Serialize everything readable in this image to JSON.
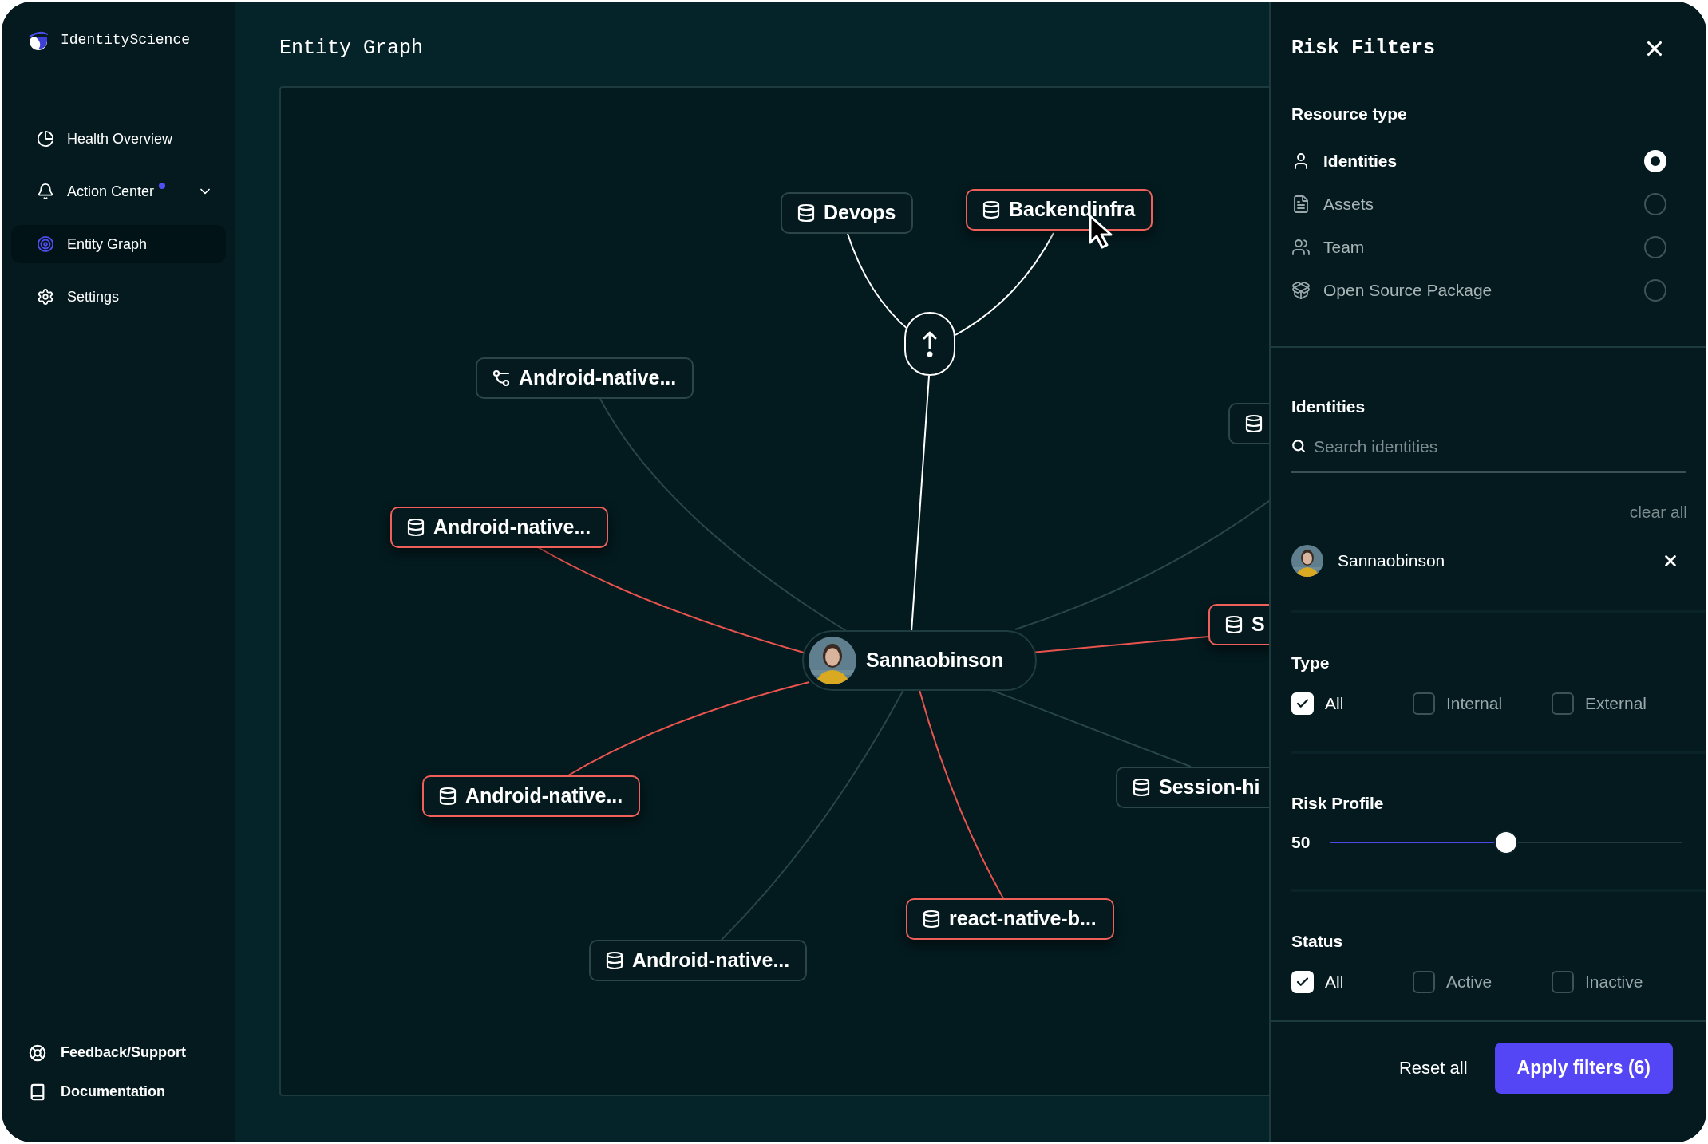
{
  "sidebar": {
    "brand": "IdentityScience",
    "nav": [
      {
        "label": "Health Overview",
        "selected": false,
        "notification": false,
        "expandable": false
      },
      {
        "label": "Action Center",
        "selected": false,
        "notification": true,
        "expandable": true
      },
      {
        "label": "Entity Graph",
        "selected": true,
        "notification": false,
        "expandable": false
      },
      {
        "label": "Settings",
        "selected": false,
        "notification": false,
        "expandable": false
      }
    ],
    "footer": [
      {
        "label": "Feedback/Support"
      },
      {
        "label": "Documentation"
      }
    ]
  },
  "main": {
    "title": "Entity Graph",
    "graph": {
      "center": {
        "label": "Sannaobinson"
      },
      "nodes": [
        {
          "label": "Devops",
          "kind": "database",
          "flagged": false
        },
        {
          "label": "Backendinfra",
          "kind": "database",
          "flagged": true
        },
        {
          "label": "Android-native...",
          "kind": "branch",
          "flagged": false
        },
        {
          "label": "Android-native...",
          "kind": "database",
          "flagged": true
        },
        {
          "kind": "database",
          "flagged": false
        },
        {
          "label": "S",
          "kind": "database",
          "flagged": true
        },
        {
          "label": "Session-hi",
          "kind": "database",
          "flagged": false
        },
        {
          "label": "Android-native...",
          "kind": "database",
          "flagged": true
        },
        {
          "label": "react-native-b...",
          "kind": "database",
          "flagged": true
        },
        {
          "label": "Android-native...",
          "kind": "database",
          "flagged": false
        }
      ]
    }
  },
  "filters": {
    "title": "Risk Filters",
    "resource_type": {
      "title": "Resource type",
      "options": [
        {
          "label": "Identities",
          "selected": true
        },
        {
          "label": "Assets",
          "selected": false
        },
        {
          "label": "Team",
          "selected": false
        },
        {
          "label": "Open Source Package",
          "selected": false
        }
      ]
    },
    "identities": {
      "title": "Identities",
      "search": {
        "placeholder": "Search identities"
      },
      "clear_all": "clear all",
      "chosen": [
        {
          "name": "Sannaobinson"
        }
      ]
    },
    "type": {
      "title": "Type",
      "options": [
        {
          "label": "All",
          "checked": true
        },
        {
          "label": "Internal",
          "checked": false
        },
        {
          "label": "External",
          "checked": false
        }
      ]
    },
    "risk_profile": {
      "title": "Risk Profile",
      "reading": "50",
      "level": 0.5
    },
    "status": {
      "title": "Status",
      "options": [
        {
          "label": "All",
          "checked": true
        },
        {
          "label": "Active",
          "checked": false
        },
        {
          "label": "Inactive",
          "checked": false
        }
      ]
    },
    "reset": "Reset all",
    "apply": "Apply filters (6)"
  }
}
